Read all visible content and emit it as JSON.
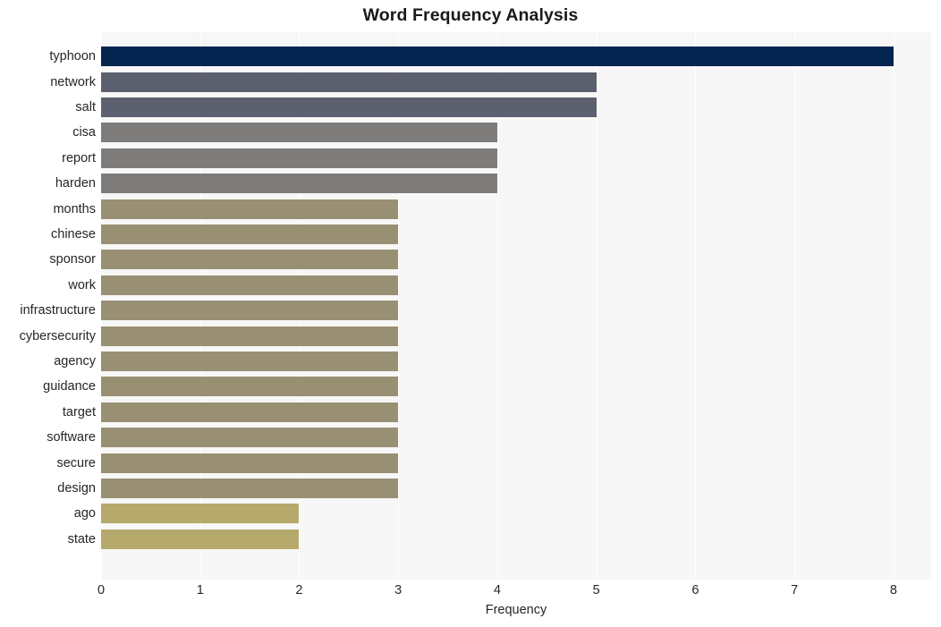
{
  "chart_data": {
    "type": "bar",
    "orientation": "horizontal",
    "title": "Word Frequency Analysis",
    "xlabel": "Frequency",
    "ylabel": "",
    "xlim": [
      0,
      8.38
    ],
    "xticks": [
      0,
      1,
      2,
      3,
      4,
      5,
      6,
      7,
      8
    ],
    "xtick_labels": [
      "0",
      "1",
      "2",
      "3",
      "4",
      "5",
      "6",
      "7",
      "8"
    ],
    "grid": "vertical-white",
    "legend": "none",
    "categories": [
      "typhoon",
      "network",
      "salt",
      "cisa",
      "report",
      "harden",
      "months",
      "chinese",
      "sponsor",
      "work",
      "infrastructure",
      "cybersecurity",
      "agency",
      "guidance",
      "target",
      "software",
      "secure",
      "design",
      "ago",
      "state"
    ],
    "values": [
      8,
      5,
      5,
      4,
      4,
      4,
      3,
      3,
      3,
      3,
      3,
      3,
      3,
      3,
      3,
      3,
      3,
      3,
      2,
      2
    ],
    "bar_colors": [
      "#03254f",
      "#5c606e",
      "#5d616f",
      "#7d7c7a",
      "#7d7c7a",
      "#7d7c7a",
      "#999073",
      "#999073",
      "#999073",
      "#999073",
      "#999073",
      "#999073",
      "#999073",
      "#999073",
      "#999073",
      "#999073",
      "#999073",
      "#999073",
      "#b6a96c",
      "#b6a96c"
    ]
  },
  "colors": {
    "figure_background": "#ffffff",
    "plot_background": "#f7f7f7",
    "gridline": "#ffffff",
    "title_text": "#1a1a1a",
    "tick_text": "#262626"
  }
}
